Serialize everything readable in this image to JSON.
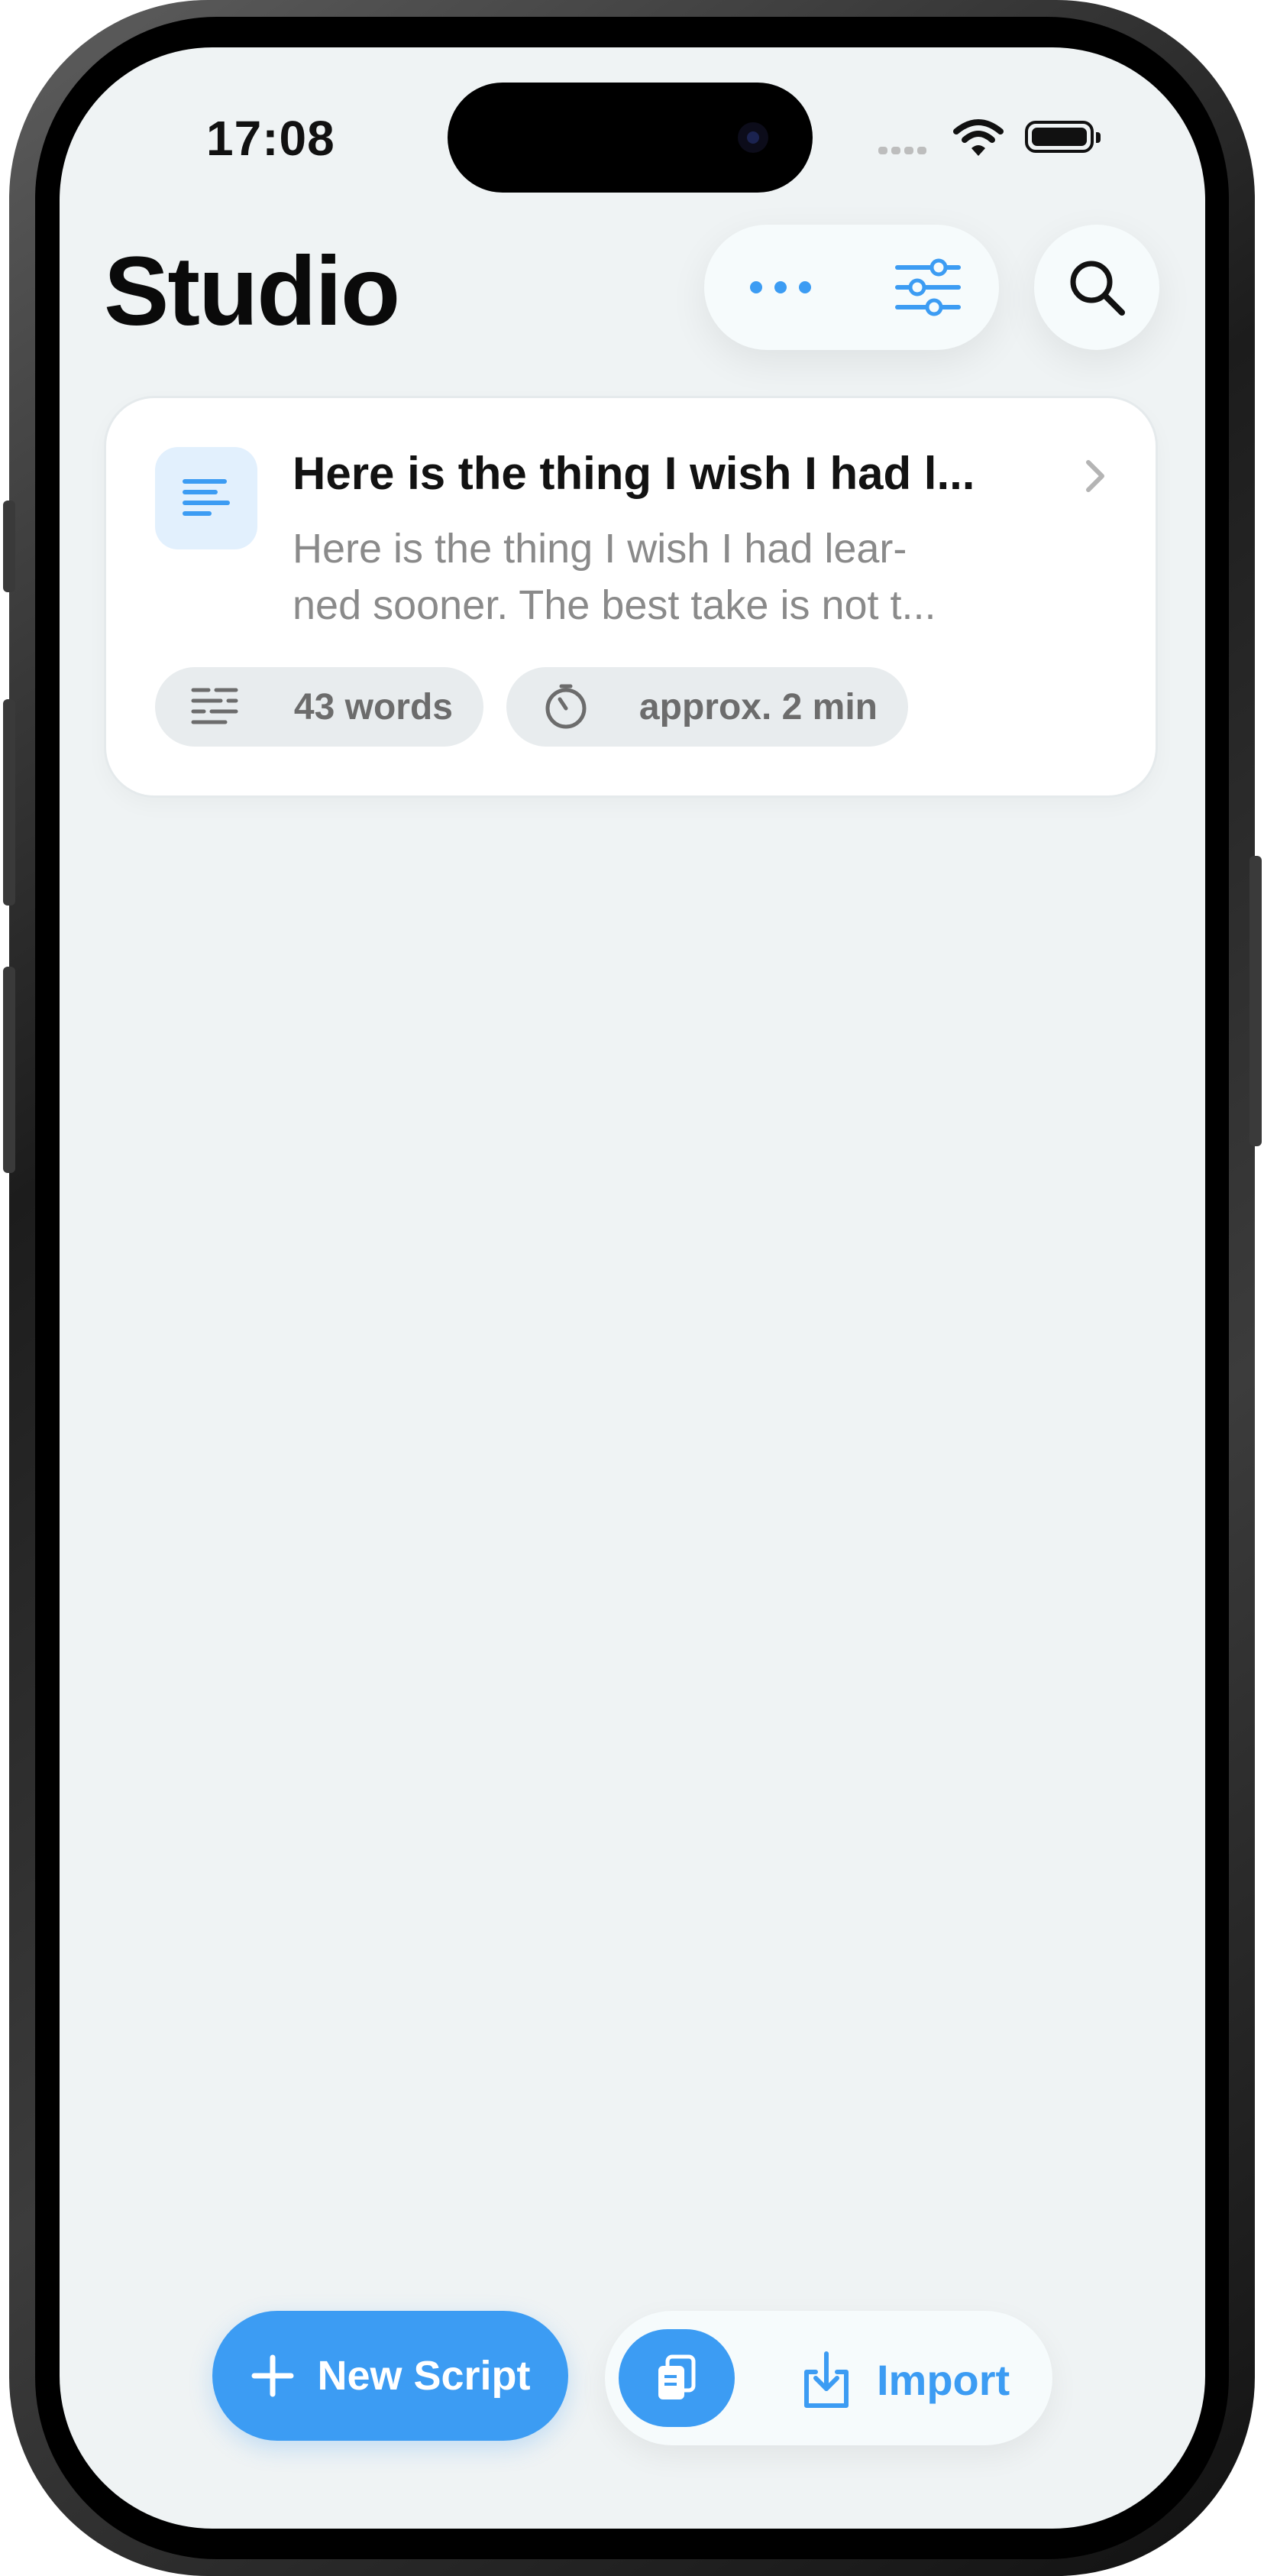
{
  "status_bar": {
    "time": "17:08"
  },
  "header": {
    "title": "Studio"
  },
  "toolbar": {
    "more_icon": "ellipsis-icon",
    "filter_icon": "sliders-icon",
    "search_icon": "search-icon"
  },
  "scripts": [
    {
      "title": "Here is the thing I wish I had l...",
      "preview": "Here is the thing I wish I had lear-\nned sooner. The best take is not t...",
      "words": "43 words",
      "duration": "approx. 2 min"
    }
  ],
  "bottom_bar": {
    "new_script_label": "New Script",
    "import_label": "Import"
  },
  "colors": {
    "accent": "#3c9cf3",
    "background": "#eff3f4",
    "card": "#ffffff",
    "chip": "#e8ecee"
  }
}
